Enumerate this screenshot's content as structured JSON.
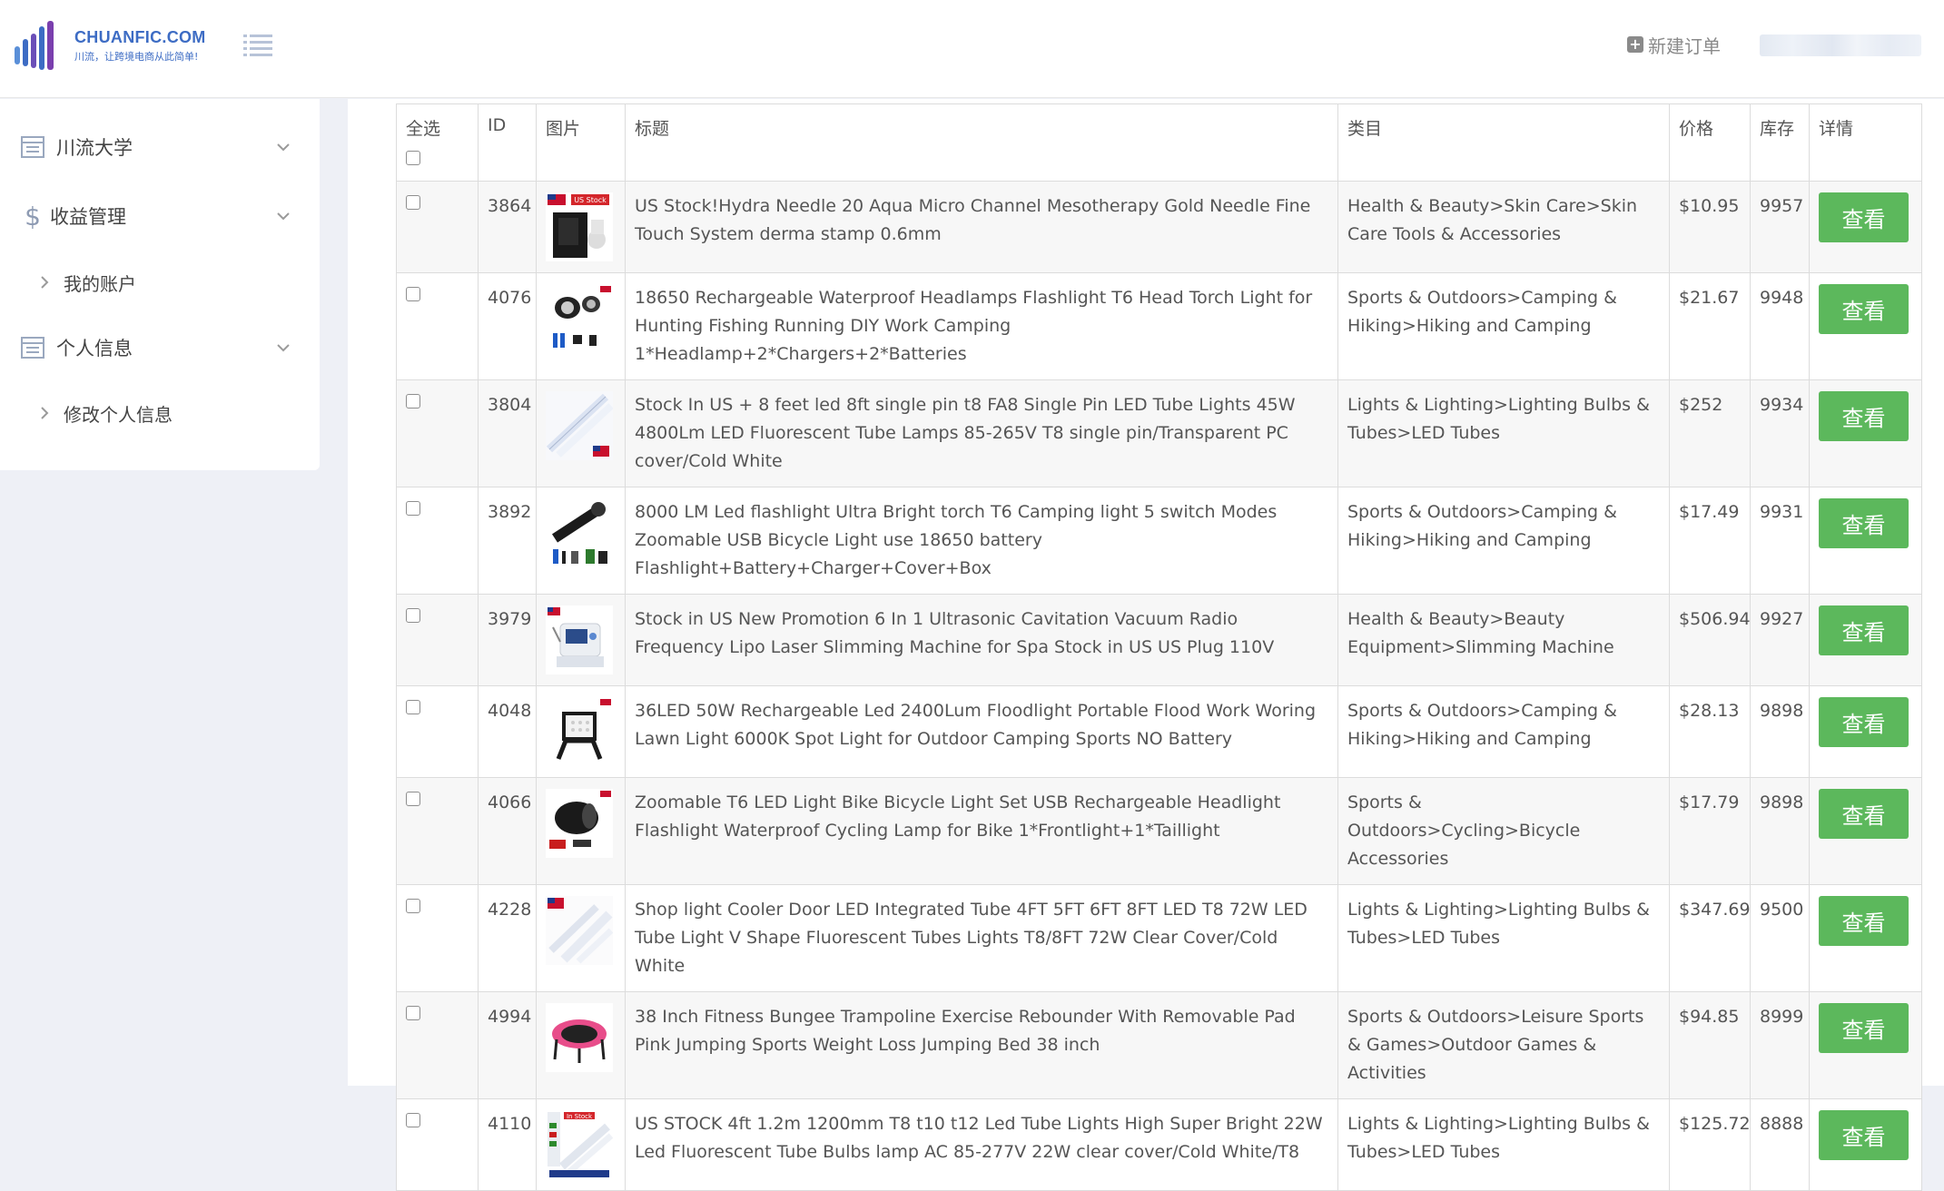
{
  "header": {
    "logo_name": "CHUANFIC.COM",
    "logo_slogan": "川流，让跨境电商从此简单!",
    "new_order_label": "新建订单"
  },
  "sidebar": {
    "items": [
      {
        "label": "川流大学",
        "icon": "list-doc-icon"
      },
      {
        "label": "收益管理",
        "icon": "dollar-icon"
      },
      {
        "label": "我的账户",
        "sub": true
      },
      {
        "label": "个人信息",
        "icon": "list-doc-icon"
      },
      {
        "label": "修改个人信息",
        "sub": true
      }
    ]
  },
  "table": {
    "headers": {
      "select_all": "全选",
      "id": "ID",
      "image": "图片",
      "title": "标题",
      "category": "类目",
      "price": "价格",
      "stock": "库存",
      "detail": "详情"
    },
    "view_label": "查看",
    "rows": [
      {
        "id": "3864",
        "title": "US Stock!Hydra Needle 20 Aqua Micro Channel Mesotherapy Gold Needle Fine Touch System derma stamp 0.6mm",
        "category": "Health & Beauty>Skin Care>Skin Care Tools & Accessories",
        "price": "$10.95",
        "stock": "9957",
        "thumb": "us-stock-needle"
      },
      {
        "id": "4076",
        "title": "18650 Rechargeable Waterproof Headlamps Flashlight T6 Head Torch Light for Hunting Fishing Running DIY Work Camping 1*Headlamp+2*Chargers+2*Batteries",
        "category": "Sports & Outdoors>Camping & Hiking>Hiking and Camping",
        "price": "$21.67",
        "stock": "9948",
        "thumb": "headlamp"
      },
      {
        "id": "3804",
        "title": "Stock In US + 8 feet led 8ft single pin t8 FA8 Single Pin LED Tube Lights 45W 4800Lm LED Fluorescent Tube Lamps 85-265V T8 single pin/Transparent PC cover/Cold White",
        "category": "Lights & Lighting>Lighting Bulbs & Tubes>LED Tubes",
        "price": "$252",
        "stock": "9934",
        "thumb": "led-tube"
      },
      {
        "id": "3892",
        "title": "8000 LM Led flashlight Ultra Bright torch T6 Camping light 5 switch Modes Zoomable USB Bicycle Light use 18650 battery Flashlight+Battery+Charger+Cover+Box",
        "category": "Sports & Outdoors>Camping & Hiking>Hiking and Camping",
        "price": "$17.49",
        "stock": "9931",
        "thumb": "flashlight"
      },
      {
        "id": "3979",
        "title": "Stock in US New Promotion 6 In 1 Ultrasonic Cavitation Vacuum Radio Frequency Lipo Laser Slimming Machine for Spa Stock in US US Plug 110V",
        "category": "Health & Beauty>Beauty Equipment>Slimming Machine",
        "price": "$506.94",
        "stock": "9927",
        "thumb": "slimming-machine"
      },
      {
        "id": "4048",
        "title": "36LED 50W Rechargeable Led 2400Lum Floodlight Portable Flood Work Woring Lawn Light 6000K Spot Light for Outdoor Camping Sports NO Battery",
        "category": "Sports & Outdoors>Camping & Hiking>Hiking and Camping",
        "price": "$28.13",
        "stock": "9898",
        "thumb": "floodlight"
      },
      {
        "id": "4066",
        "title": "Zoomable T6 LED Light Bike Bicycle Light Set USB Rechargeable Headlight Flashlight Waterproof Cycling Lamp for Bike 1*Frontlight+1*Taillight",
        "category": "Sports & Outdoors>Cycling>Bicycle Accessories",
        "price": "$17.79",
        "stock": "9898",
        "thumb": "bike-light"
      },
      {
        "id": "4228",
        "title": "Shop light Cooler Door LED Integrated Tube 4FT 5FT 6FT 8FT LED T8 72W LED Tube Light V Shape Fluorescent Tubes Lights T8/8FT 72W Clear Cover/Cold White",
        "category": "Lights & Lighting>Lighting Bulbs & Tubes>LED Tubes",
        "price": "$347.69",
        "stock": "9500",
        "thumb": "v-tube"
      },
      {
        "id": "4994",
        "title": "38 Inch Fitness Bungee Trampoline Exercise Rebounder With Removable Pad Pink Jumping Sports Weight Loss Jumping Bed 38 inch",
        "category": "Sports & Outdoors>Leisure Sports & Games>Outdoor Games & Activities",
        "price": "$94.85",
        "stock": "8999",
        "thumb": "trampoline"
      },
      {
        "id": "4110",
        "title": "US STOCK 4ft 1.2m 1200mm T8 t10 t12 Led Tube Lights High Super Bright 22W Led Fluorescent Tube Bulbs lamp AC 85-277V 22W clear cover/Cold White/T8",
        "category": "Lights & Lighting>Lighting Bulbs & Tubes>LED Tubes",
        "price": "$125.72",
        "stock": "8888",
        "thumb": "tube-bundle"
      }
    ]
  },
  "colors": {
    "accent_blue": "#3d6cc4",
    "view_button_green": "#5cb85c",
    "page_background": "#eef0f6"
  }
}
